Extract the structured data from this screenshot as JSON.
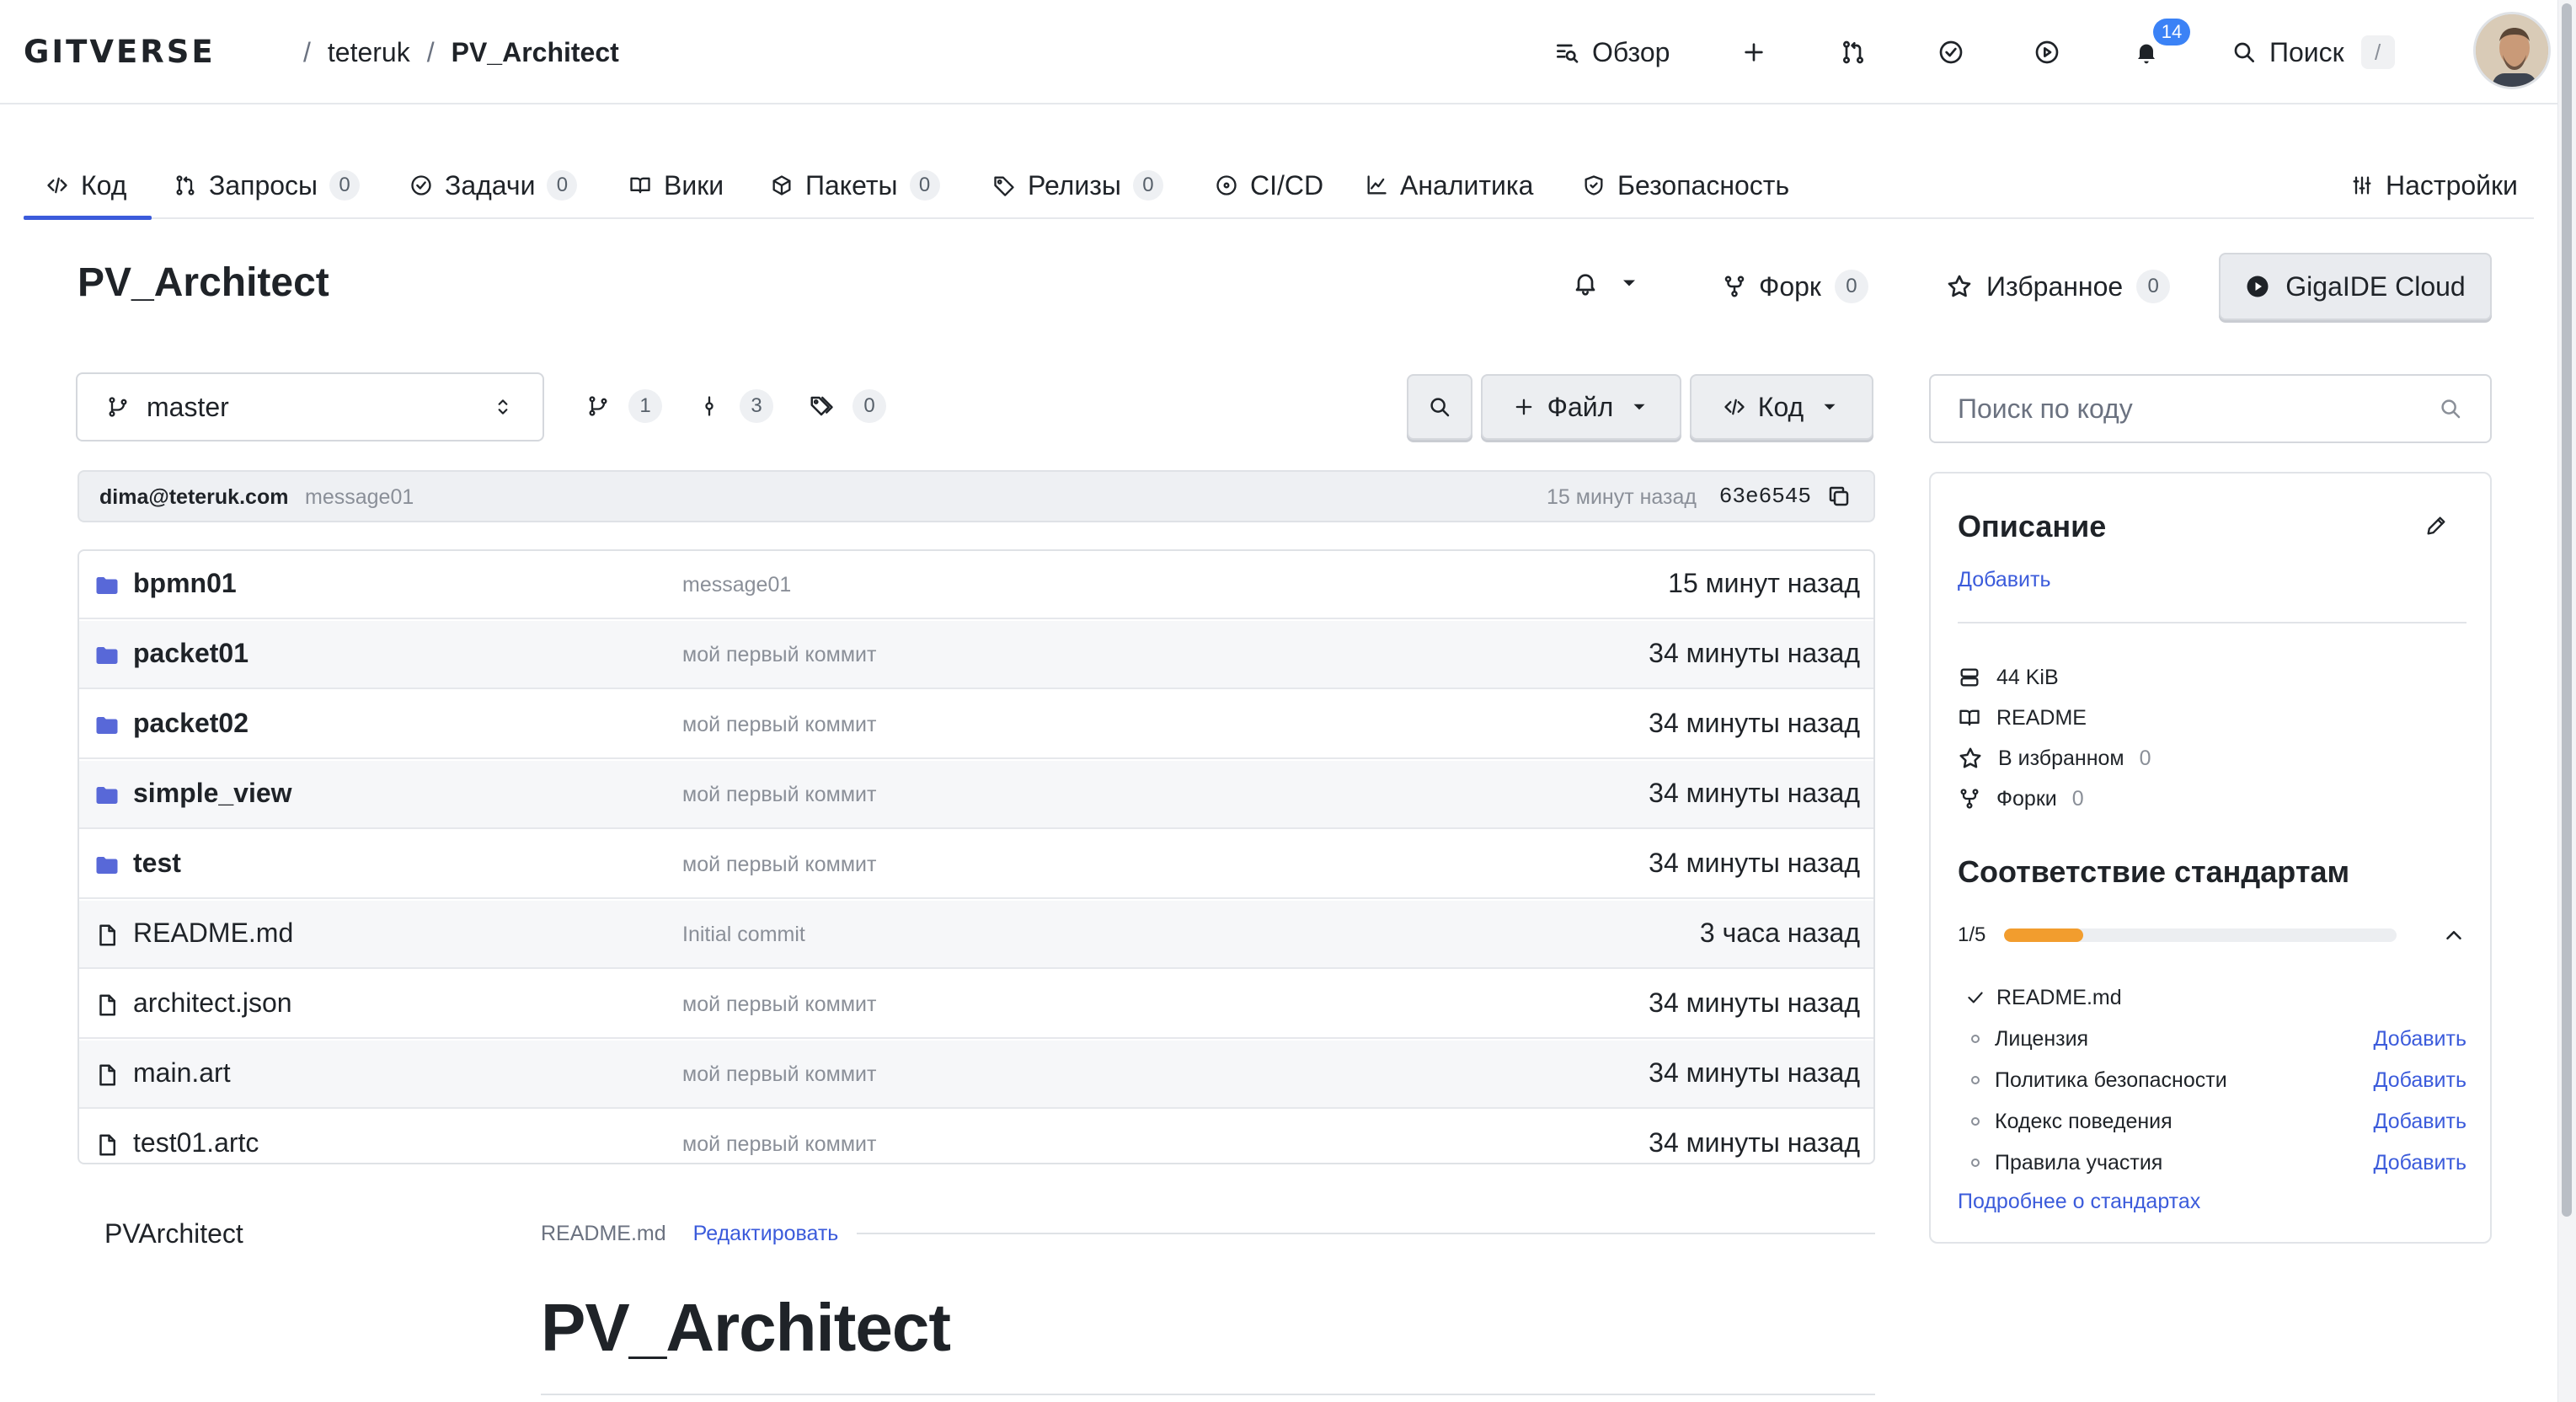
{
  "header": {
    "logo": "GITVERSE",
    "breadcrumb": {
      "owner": "teteruk",
      "repo": "PV_Architect",
      "separator": "/"
    },
    "overview_label": "Обзор",
    "notifications_count": "14",
    "search_label": "Поиск",
    "search_shortcut": "/"
  },
  "tabs": [
    {
      "label": "Код"
    },
    {
      "label": "Запросы",
      "count": "0"
    },
    {
      "label": "Задачи",
      "count": "0"
    },
    {
      "label": "Вики"
    },
    {
      "label": "Пакеты",
      "count": "0"
    },
    {
      "label": "Релизы",
      "count": "0"
    },
    {
      "label": "CI/CD"
    },
    {
      "label": "Аналитика"
    },
    {
      "label": "Безопасность"
    },
    {
      "label": "Настройки"
    }
  ],
  "repo": {
    "title": "PV_Architect",
    "fork_label": "Форк",
    "fork_count": "0",
    "favorite_label": "Избранное",
    "favorite_count": "0",
    "gigaide_label": "GigaIDE Cloud"
  },
  "toolbar": {
    "branch": "master",
    "branches_count": "1",
    "commits_count": "3",
    "tags_count": "0",
    "file_button": "Файл",
    "code_button": "Код"
  },
  "code_search": {
    "placeholder": "Поиск по коду"
  },
  "last_commit": {
    "author": "dima@teteruk.com",
    "message": "message01",
    "time": "15 минут назад",
    "hash": "63e6545"
  },
  "files": [
    {
      "name": "bpmn01",
      "type": "dir",
      "message": "message01",
      "time": "15 минут назад"
    },
    {
      "name": "packet01",
      "type": "dir",
      "message": "мой первый коммит",
      "time": "34 минуты назад"
    },
    {
      "name": "packet02",
      "type": "dir",
      "message": "мой первый коммит",
      "time": "34 минуты назад"
    },
    {
      "name": "simple_view",
      "type": "dir",
      "message": "мой первый коммит",
      "time": "34 минуты назад"
    },
    {
      "name": "test",
      "type": "dir",
      "message": "мой первый коммит",
      "time": "34 минуты назад"
    },
    {
      "name": "README.md",
      "type": "file",
      "message": "Initial commit",
      "time": "3 часа назад"
    },
    {
      "name": "architect.json",
      "type": "file",
      "message": "мой первый коммит",
      "time": "34 минуты назад"
    },
    {
      "name": "main.art",
      "type": "file",
      "message": "мой первый коммит",
      "time": "34 минуты назад"
    },
    {
      "name": "test01.artc",
      "type": "file",
      "message": "мой первый коммит",
      "time": "34 минуты назад"
    }
  ],
  "readme": {
    "side_title": "PVArchitect",
    "filename": "README.md",
    "edit_label": "Редактировать",
    "heading": "PV_Architect"
  },
  "sidebar": {
    "description_title": "Описание",
    "add_label": "Добавить",
    "size": "44 KiB",
    "readme_label": "README",
    "favorites_label": "В избранном",
    "favorites_count": "0",
    "forks_label": "Форки",
    "forks_count": "0",
    "standards_title": "Соответствие стандартам",
    "progress_text": "1/5",
    "progress_fraction": 0.2,
    "standards": [
      {
        "label": "README.md",
        "done": true
      },
      {
        "label": "Лицензия",
        "done": false,
        "action": "Добавить"
      },
      {
        "label": "Политика безопасности",
        "done": false,
        "action": "Добавить"
      },
      {
        "label": "Кодекс поведения",
        "done": false,
        "action": "Добавить"
      },
      {
        "label": "Правила участия",
        "done": false,
        "action": "Добавить"
      }
    ],
    "more_link": "Подробнее о стандартах"
  },
  "colors": {
    "accent": "#3b5bdb",
    "folder": "#5868d8",
    "progress": "#f29d2e",
    "notification_badge": "#3b82f6"
  }
}
